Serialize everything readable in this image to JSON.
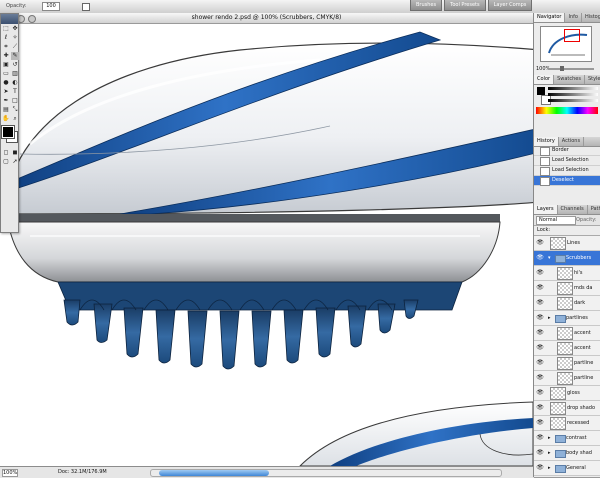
{
  "options_bar": {
    "label": "Opacity:",
    "field_value": "100"
  },
  "panel_wells": [
    "Brushes",
    "Tool Presets",
    "Layer Comps"
  ],
  "document": {
    "title": "shower rendo 2.psd @ 100% (Scrubbers, CMYK/8)",
    "zoom": "100%",
    "doc_info": "Doc: 32.1M/176.9M"
  },
  "navigator": {
    "tabs": [
      "Navigator",
      "Info",
      "Histogram"
    ],
    "zoom": "100%"
  },
  "color_panel": {
    "tabs": [
      "Color",
      "Swatches",
      "Styles"
    ],
    "accent": "#1f5aa3"
  },
  "history": {
    "tabs": [
      "History",
      "Actions"
    ],
    "items": [
      {
        "label": "Border",
        "active": false
      },
      {
        "label": "Load Selection",
        "active": false
      },
      {
        "label": "Load Selection",
        "active": false
      },
      {
        "label": "Deselect",
        "active": true
      }
    ]
  },
  "layers": {
    "tabs": [
      "Layers",
      "Channels",
      "Paths"
    ],
    "blend_mode": "Normal",
    "opacity_label": "Opacity:",
    "lock_label": "Lock:",
    "items": [
      {
        "name": "Lines",
        "indent": 0,
        "type": "layer",
        "active": false
      },
      {
        "name": "Scrubbers",
        "indent": 0,
        "type": "folder",
        "active": true
      },
      {
        "name": "hi's",
        "indent": 1,
        "type": "layer",
        "active": false
      },
      {
        "name": "mds da",
        "indent": 1,
        "type": "layer",
        "active": false
      },
      {
        "name": "dark",
        "indent": 1,
        "type": "layer",
        "active": false
      },
      {
        "name": "partlines",
        "indent": 0,
        "type": "folder",
        "active": false
      },
      {
        "name": "accent",
        "indent": 1,
        "type": "layer",
        "active": false
      },
      {
        "name": "accent",
        "indent": 1,
        "type": "layer",
        "active": false
      },
      {
        "name": "partline",
        "indent": 1,
        "type": "layer",
        "active": false
      },
      {
        "name": "partline",
        "indent": 1,
        "type": "layer",
        "active": false
      },
      {
        "name": "gloss",
        "indent": 0,
        "type": "layer",
        "active": false
      },
      {
        "name": "drop shado",
        "indent": 0,
        "type": "layer",
        "active": false
      },
      {
        "name": "recessed",
        "indent": 0,
        "type": "layer",
        "active": false
      },
      {
        "name": "contrast",
        "indent": 0,
        "type": "folder",
        "active": false
      },
      {
        "name": "body shad",
        "indent": 0,
        "type": "folder",
        "active": false
      },
      {
        "name": "General",
        "indent": 0,
        "type": "folder",
        "active": false
      }
    ]
  },
  "colors": {
    "accent_blue": "#1f5aa3",
    "dark_blue": "#123e72",
    "selection": "#3875d7"
  }
}
